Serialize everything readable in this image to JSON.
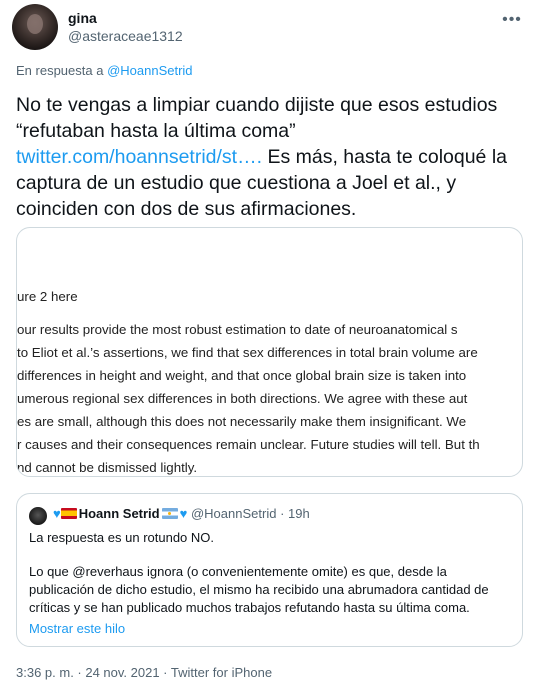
{
  "author": {
    "name": "gina",
    "handle": "@asteraceae1312"
  },
  "more_icon": "more-horizontal-icon",
  "reply": {
    "prefix": "En respuesta a ",
    "to": "@HoannSetrid"
  },
  "tweet": {
    "text_before_link": "No te vengas a limpiar cuando dijiste que esos estudios “refutaban hasta la última coma”",
    "link": "twitter.com/hoannsetrid/st….",
    "text_after_link": " Es más, hasta te coloqué la captura de un estudio que cuestiona a Joel et al., y coinciden con dos de sus afirmaciones."
  },
  "media": {
    "lines": [
      "ure 2 here",
      "our results provide the most robust estimation to date of neuroanatomical s",
      "to Eliot et al.’s assertions, we find that sex differences in total brain volume are",
      " differences in height and weight, and that once global brain size is taken into",
      "umerous regional sex differences in both directions. We agree with these aut",
      "es are small, although this does not necessarily make them insignificant.  We",
      "r causes and their consequences remain unclear. Future studies will tell. But th",
      "nd cannot be dismissed lightly."
    ]
  },
  "quote": {
    "name": "Hoann Setrid",
    "handle": "@HoannSetrid",
    "separator": "·",
    "time": "19h",
    "line1": "La respuesta es un rotundo NO.",
    "para": [
      "Lo que @reverhaus ignora (o convenientemente omite) es que, desde la",
      "publicación de dicho estudio, el mismo ha recibido una abrumadora cantidad de",
      "críticas y se han publicado muchos trabajos refutando hasta su última coma."
    ],
    "show_thread": "Mostrar este hilo"
  },
  "footer": {
    "timestamp": "3:36 p. m. · 24 nov. 2021 · Twitter for iPhone"
  }
}
